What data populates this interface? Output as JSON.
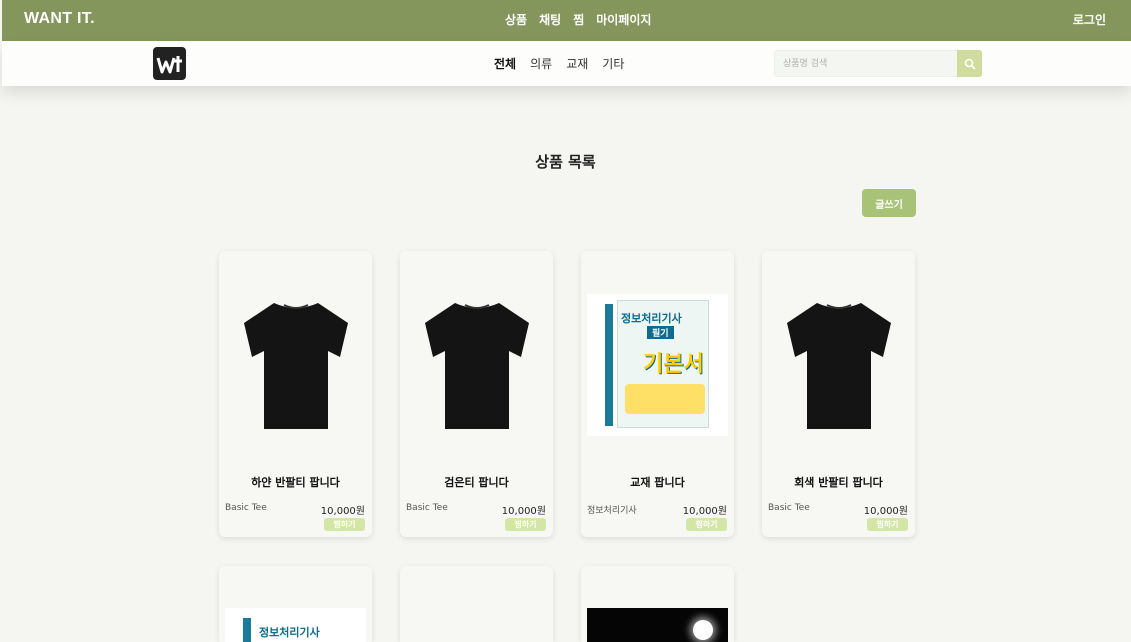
{
  "header": {
    "brand": "WANT IT.",
    "nav": [
      "상품",
      "채팅",
      "찜",
      "마이페이지"
    ],
    "login": "로그인"
  },
  "subheader": {
    "logo_alt": "wt",
    "categories": [
      "전체",
      "의류",
      "교재",
      "기타"
    ],
    "active_category": "전체",
    "search_placeholder": "상품명 검색"
  },
  "main": {
    "title": "상품 목록",
    "write_label": "글쓰기",
    "products": [
      {
        "name": "하얀 반팔티 팝니다",
        "subtitle": "Basic Tee",
        "price": "10,000원",
        "like": "찜하기",
        "image": "black-tshirt"
      },
      {
        "name": "검은티 팝니다",
        "subtitle": "Basic Tee",
        "price": "10,000원",
        "like": "찜하기",
        "image": "black-tshirt"
      },
      {
        "name": "교재 팝니다",
        "subtitle": "정보처리기사",
        "price": "10,000원",
        "like": "찜하기",
        "image": "textbook"
      },
      {
        "name": "회색 반팔티 팝니다",
        "subtitle": "Basic Tee",
        "price": "10,000원",
        "like": "찜하기",
        "image": "black-tshirt"
      }
    ],
    "book": {
      "line1": "정보처리기사",
      "line2": "필기",
      "line3": "기본서"
    }
  },
  "colors": {
    "accent": "#84965b",
    "button": "#a8c278",
    "like": "#d4e6a5"
  }
}
